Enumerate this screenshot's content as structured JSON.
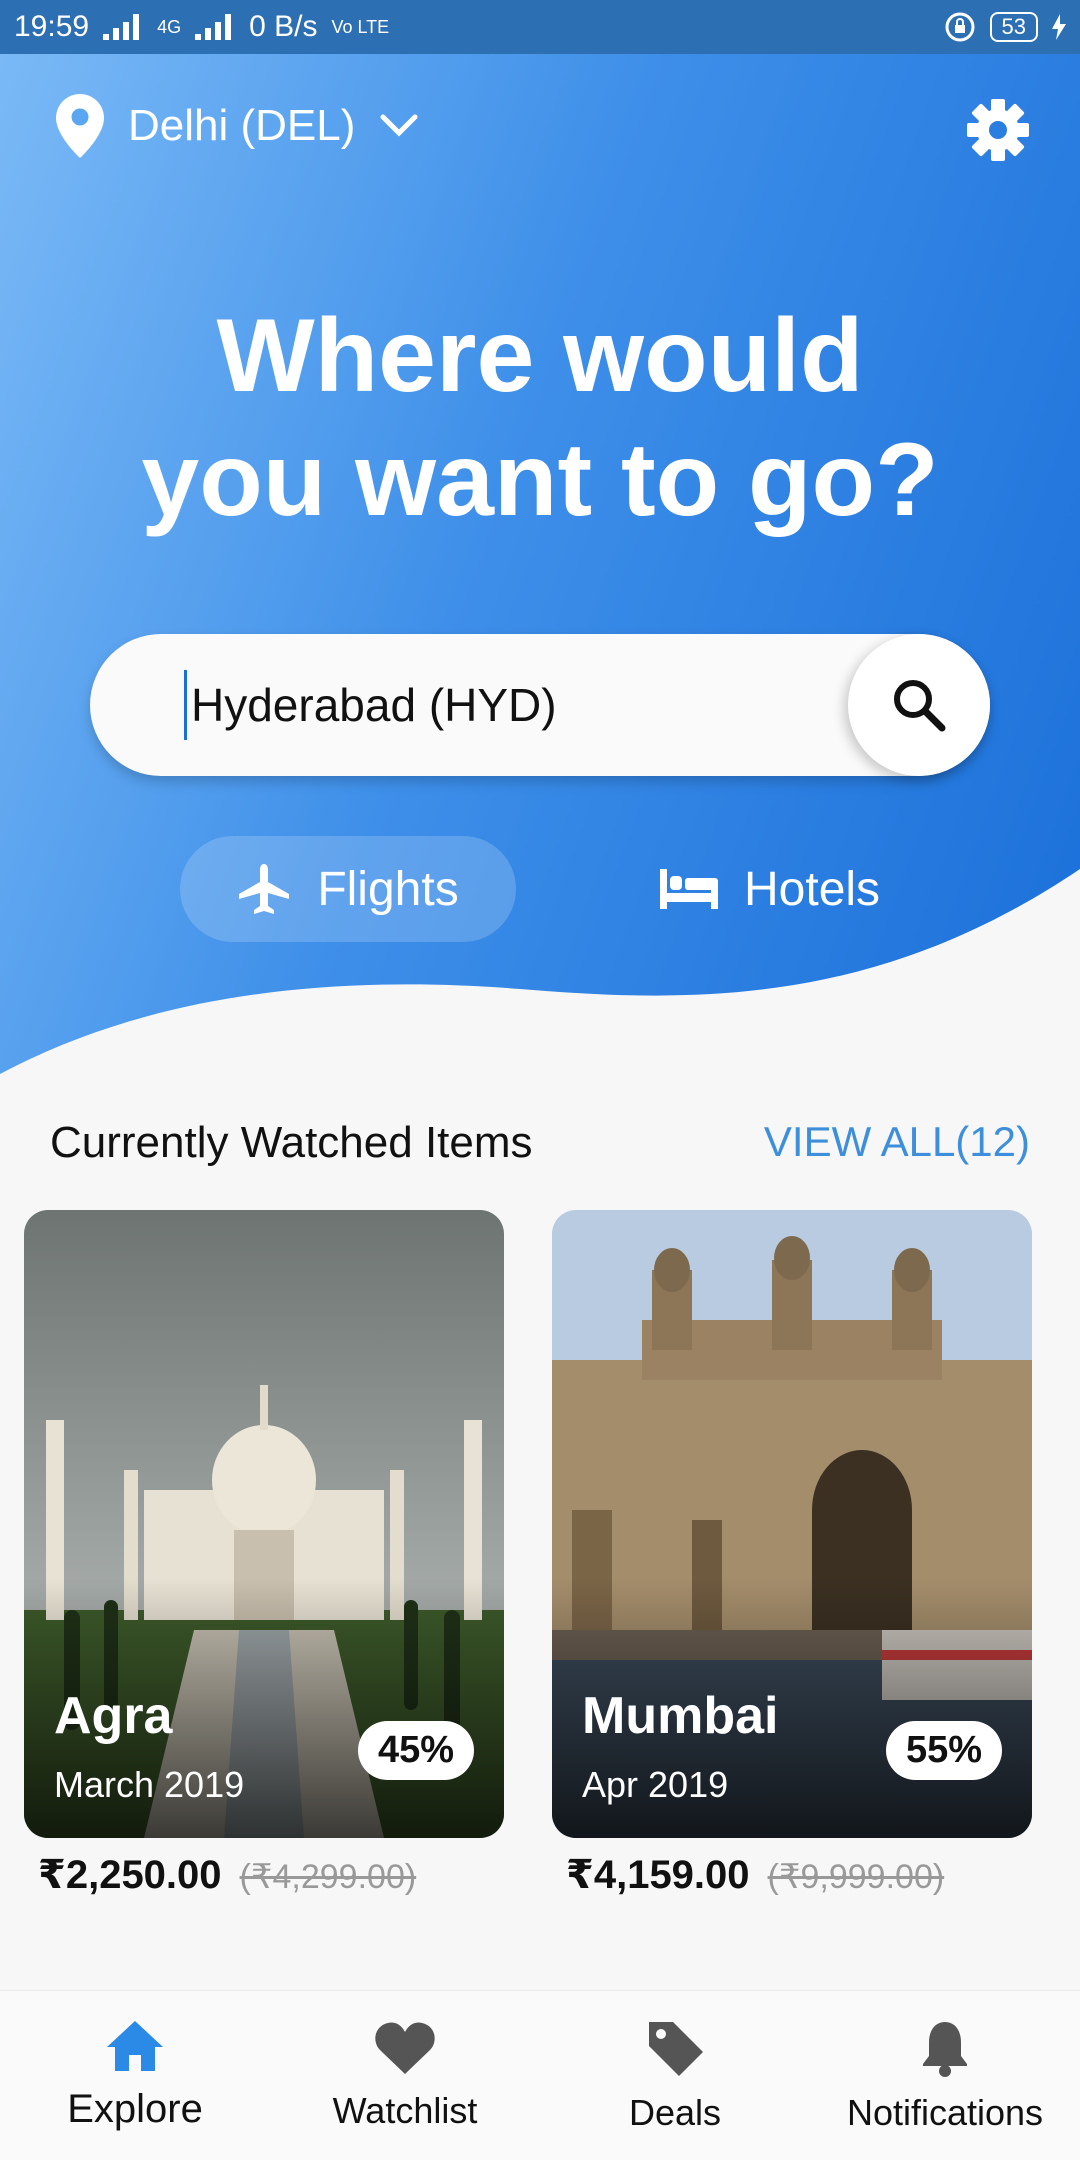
{
  "status_bar": {
    "time": "19:59",
    "net_speed": "0 B/s",
    "net_type": "4G",
    "volte": "Vo LTE",
    "battery": "53"
  },
  "header": {
    "location": "Delhi (DEL)"
  },
  "hero": {
    "headline_line1": "Where would",
    "headline_line2": "you want to go?"
  },
  "search": {
    "value": "Hyderabad (HYD)"
  },
  "modes": [
    {
      "label": "Flights",
      "icon": "airplane-icon",
      "selected": true
    },
    {
      "label": "Hotels",
      "icon": "bed-icon",
      "selected": false
    }
  ],
  "watched": {
    "title": "Currently Watched Items",
    "view_all": "VIEW ALL(12)",
    "items": [
      {
        "city": "Agra",
        "date": "March 2019",
        "discount": "45%",
        "price": "₹2,250.00",
        "old_price": "(₹4,299.00)"
      },
      {
        "city": "Mumbai",
        "date": "Apr 2019",
        "discount": "55%",
        "price": "₹4,159.00",
        "old_price": "(₹9,999.00)"
      }
    ]
  },
  "nav": [
    {
      "label": "Explore",
      "icon": "home-icon",
      "active": true
    },
    {
      "label": "Watchlist",
      "icon": "heart-icon",
      "active": false
    },
    {
      "label": "Deals",
      "icon": "tag-icon",
      "active": false
    },
    {
      "label": "Notifications",
      "icon": "bell-icon",
      "active": false
    }
  ],
  "colors": {
    "accent": "#1a6fd9",
    "link": "#3d8fdc",
    "active_nav": "#2b8ae6",
    "inactive_nav": "#555555"
  }
}
